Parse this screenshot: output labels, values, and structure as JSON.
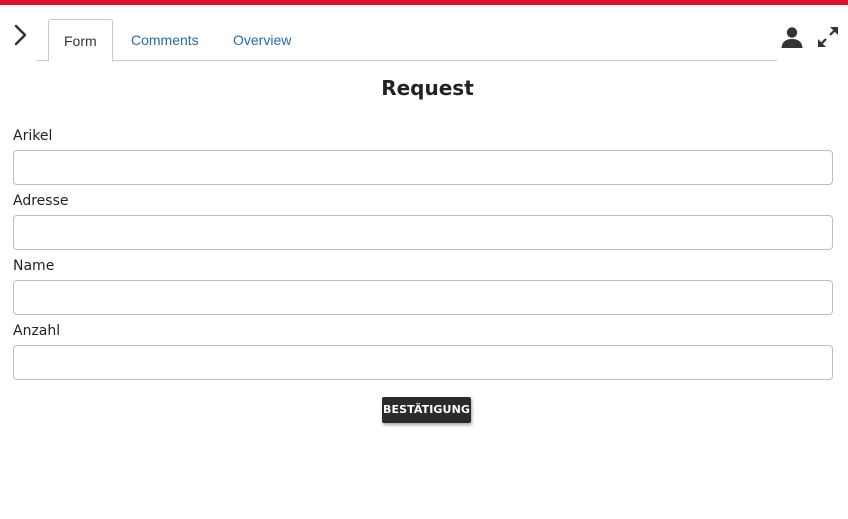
{
  "colors": {
    "accent_bar": "#e0102a",
    "tab_link": "#2a6aa8",
    "button_bg": "#2b2b2b"
  },
  "nav": {
    "toggle_icon": "chevron-right-icon"
  },
  "tabs": [
    {
      "label": "Form",
      "active": true
    },
    {
      "label": "Comments",
      "active": false
    },
    {
      "label": "Overview",
      "active": false
    }
  ],
  "header_icons": {
    "user": "user-icon",
    "expand": "expand-icon"
  },
  "form": {
    "title": "Request",
    "fields": [
      {
        "label": "Arikel",
        "value": "",
        "placeholder": ""
      },
      {
        "label": "Adresse",
        "value": "",
        "placeholder": ""
      },
      {
        "label": "Name",
        "value": "",
        "placeholder": ""
      },
      {
        "label": "Anzahl",
        "value": "",
        "placeholder": ""
      }
    ],
    "submit_label": "BESTÄTIGUNG"
  }
}
